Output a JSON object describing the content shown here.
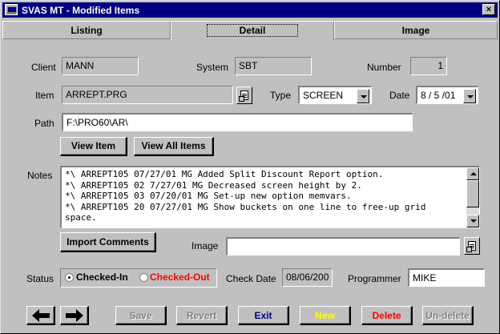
{
  "window": {
    "title": "SVAS MT - Modified Items",
    "close_glyph": "×"
  },
  "tabs": [
    {
      "label": "Listing",
      "active": false
    },
    {
      "label": "Detail",
      "active": true
    },
    {
      "label": "Image",
      "active": false
    }
  ],
  "fields": {
    "client": {
      "label": "Client",
      "value": "MANN"
    },
    "system": {
      "label": "System",
      "value": "SBT"
    },
    "number": {
      "label": "Number",
      "value": "1"
    },
    "item": {
      "label": "Item",
      "value": "ARREPT.PRG"
    },
    "type": {
      "label": "Type",
      "value": "SCREEN"
    },
    "date": {
      "label": "Date",
      "value": "8 / 5 /01"
    },
    "path": {
      "label": "Path",
      "value": "F:\\PRO60\\AR\\"
    },
    "image": {
      "label": "Image",
      "value": ""
    },
    "check_date": {
      "label": "Check Date",
      "value": "08/06/200"
    },
    "programmer": {
      "label": "Programmer",
      "value": "MIKE"
    }
  },
  "buttons": {
    "view_item": "View Item",
    "view_all_items": "View All Items",
    "import_comments": "Import Comments",
    "save": "Save",
    "revert": "Revert",
    "exit": "Exit",
    "new": "New",
    "delete": "Delete",
    "undelete": "Un-delete"
  },
  "notes": {
    "label": "Notes",
    "lines": [
      "*\\ ARREPT105 07/27/01 MG Added Split Discount Report option.",
      "*\\ ARREPT105 02 7/27/01 MG Decreased screen height by 2.",
      "*\\ ARREPT105 03 07/20/01 MG Set-up new option memvars.",
      "*\\ ARREPT105 20 07/27/01 MG Show buckets on one line to free-up grid",
      "space."
    ]
  },
  "status": {
    "label": "Status",
    "options": [
      {
        "label": "Checked-In",
        "selected": true,
        "color": "#000000"
      },
      {
        "label": "Checked-Out",
        "selected": false,
        "color": "#ff0000"
      }
    ]
  },
  "colors": {
    "title_bar": "#000080",
    "exit_text": "#000080",
    "new_text": "#ffff00",
    "delete_text": "#ff0000",
    "checked_out_text": "#ff0000"
  },
  "icons": {
    "prev": "arrow-left-icon",
    "next": "arrow-right-icon",
    "browse": "browse-file-icon"
  }
}
